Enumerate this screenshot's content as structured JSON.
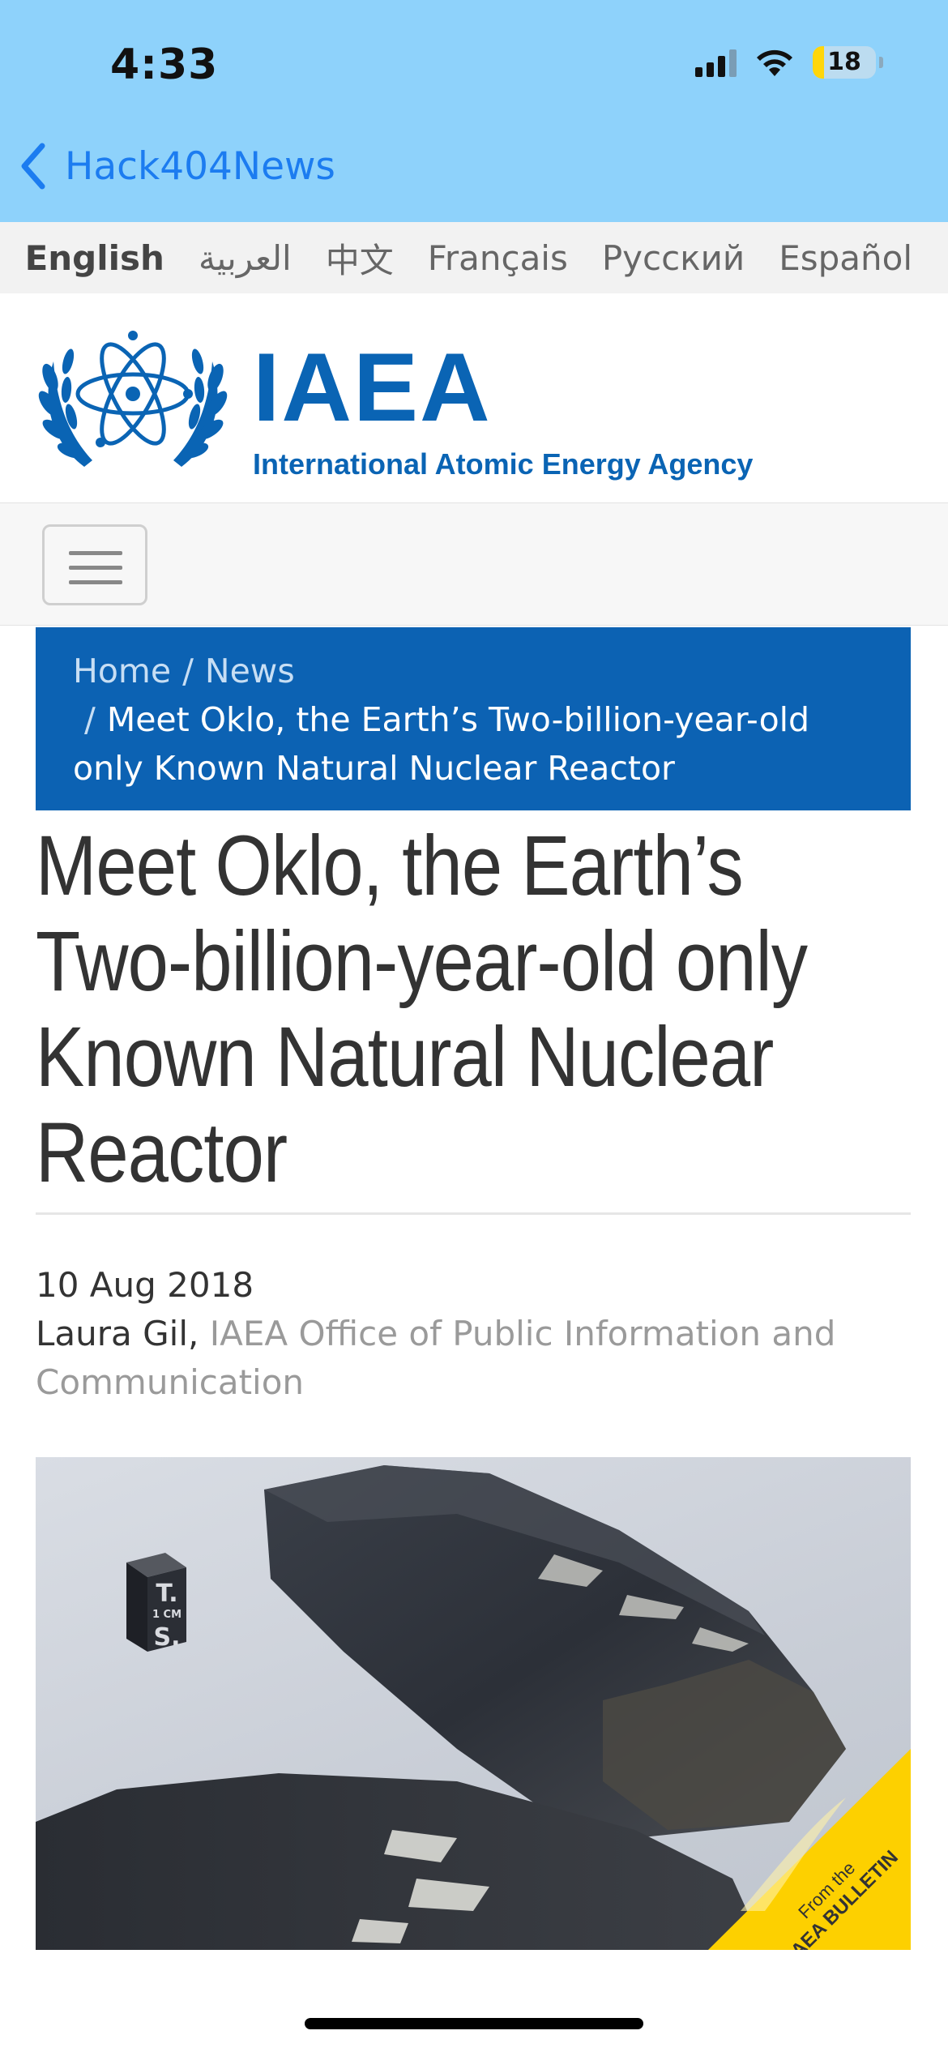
{
  "status_bar": {
    "time": "4:33",
    "battery_level": "18",
    "battery_fraction": 0.18
  },
  "nav": {
    "back_label": "Hack404News"
  },
  "languages": [
    {
      "label": "English",
      "active": true
    },
    {
      "label": "العربية",
      "active": false
    },
    {
      "label": "中文",
      "active": false
    },
    {
      "label": "Français",
      "active": false
    },
    {
      "label": "Русский",
      "active": false
    },
    {
      "label": "Español",
      "active": false
    }
  ],
  "logo": {
    "abbr": "IAEA",
    "name": "International Atomic Energy Agency"
  },
  "breadcrumb": {
    "home": "Home",
    "news": "News",
    "current": "Meet Oklo, the Earth’s Two-billion-year-old only Known Natural Nuclear Reactor"
  },
  "article": {
    "title": "Meet Oklo, the Earth’s Two-billion-year-old only Known Natural Nuclear Reactor",
    "date": "10 Aug 2018",
    "author": "Laura Gil,",
    "office": "IAEA Office of Public Information and Communication"
  },
  "photo": {
    "cube_top": "T.",
    "cube_mid": "1 CM",
    "cube_bottom": "S.",
    "badge_small": "From the",
    "badge_big": "IAEA BULLETIN"
  },
  "colors": {
    "topbar": "#8ed2fb",
    "ios_link": "#1c7cf0",
    "iaea_blue": "#0a64b4",
    "badge_yellow": "#fdd000"
  }
}
